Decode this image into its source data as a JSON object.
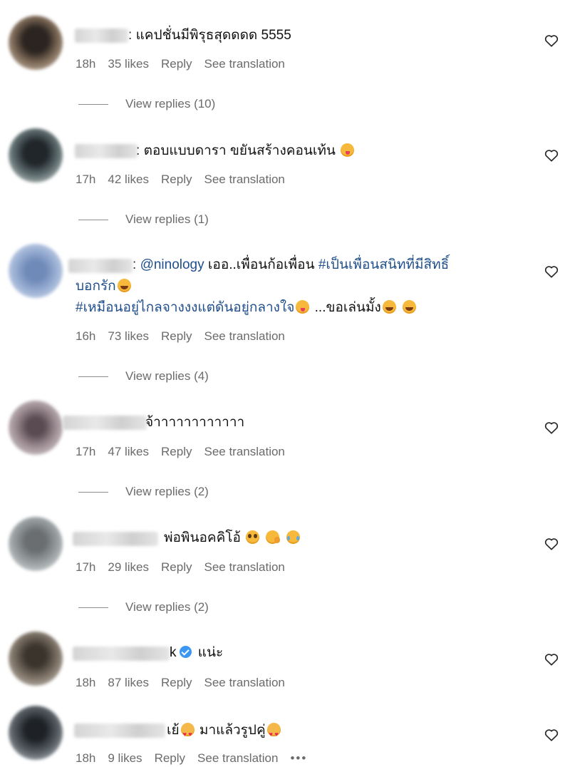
{
  "comments": [
    {
      "segments": [
        {
          "t": "แคปชั่นมีพิรุธสุดดดด 5555"
        }
      ],
      "time": "18h",
      "likes": "35 likes",
      "reply": "Reply",
      "translate": "See translation",
      "view_replies": "View replies (10)"
    },
    {
      "segments": [
        {
          "t": "ตอบแบบดารา ขยันสร้างคอนเท้น"
        }
      ],
      "time": "17h",
      "likes": "42 likes",
      "reply": "Reply",
      "translate": "See translation",
      "view_replies": "View replies (1)"
    },
    {
      "line1_mention": "@ninology",
      "line1_text": "เออ..เพื่อนก้อเพื่อน",
      "line1_hashtag": "#เป็นเพื่อนสนิทที่มีสิทธิ์",
      "line2_hashtag": "บอกรัก",
      "line3_hashtag": "#เหมือนอยู่ไกลจางงงแต่ดันอยู่กลางใจ",
      "line3_text": "...ขอเล่นมั้ง",
      "time": "16h",
      "likes": "73 likes",
      "reply": "Reply",
      "translate": "See translation",
      "view_replies": "View replies (4)"
    },
    {
      "segments": [
        {
          "t": "จ้าาาาาาาาาาาา"
        }
      ],
      "time": "17h",
      "likes": "47 likes",
      "reply": "Reply",
      "translate": "See translation",
      "view_replies": "View replies (2)"
    },
    {
      "segments": [
        {
          "t": "พ่อพินอคคิโอ้"
        }
      ],
      "time": "17h",
      "likes": "29 likes",
      "reply": "Reply",
      "translate": "See translation",
      "view_replies": "View replies (2)"
    },
    {
      "name_suffix": "k",
      "segments": [
        {
          "t": "แน่ะ"
        }
      ],
      "time": "18h",
      "likes": "87 likes",
      "reply": "Reply",
      "translate": "See translation"
    },
    {
      "name_suffix": "เย้",
      "segments": [
        {
          "t": "มาแล้วรูปคู่"
        }
      ],
      "time": "18h",
      "likes": "9 likes",
      "reply": "Reply",
      "translate": "See translation",
      "more": "•••"
    }
  ],
  "icons": {
    "like": "heart-outline-icon",
    "verified": "verified-badge-icon",
    "more": "more-options-icon"
  },
  "colors": {
    "link": "#1f4e8c",
    "meta": "#6b6b6b",
    "verified": "#3b97f1"
  }
}
